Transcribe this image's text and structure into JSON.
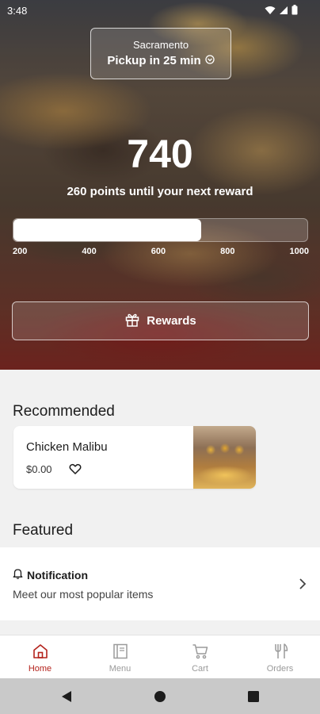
{
  "status_bar": {
    "time": "3:48"
  },
  "location": {
    "city": "Sacramento",
    "pickup": "Pickup in 25 min"
  },
  "rewards": {
    "points": "740",
    "points_to_next": "260 points until your next reward",
    "progress_fraction": 0.64,
    "scale_labels": [
      "200",
      "400",
      "600",
      "800",
      "1000"
    ],
    "button_label": "Rewards"
  },
  "recommended": {
    "title": "Recommended",
    "item": {
      "name": "Chicken Malibu",
      "price": "$0.00"
    }
  },
  "featured": {
    "title": "Featured",
    "notification": {
      "title": "Notification",
      "subtitle": "Meet our most popular items"
    }
  },
  "bottom_nav": {
    "items": [
      {
        "label": "Home",
        "icon": "home-icon",
        "active": true
      },
      {
        "label": "Menu",
        "icon": "menu-book-icon",
        "active": false
      },
      {
        "label": "Cart",
        "icon": "cart-icon",
        "active": false
      },
      {
        "label": "Orders",
        "icon": "fork-knife-icon",
        "active": false
      }
    ]
  },
  "colors": {
    "accent": "#b4231c",
    "inactive": "#9a9a9a"
  }
}
